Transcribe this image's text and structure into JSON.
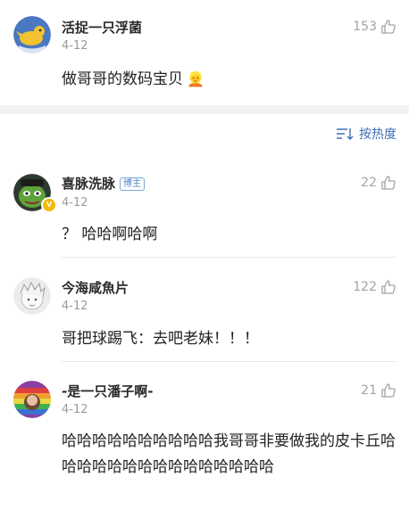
{
  "post": {
    "username": "活捉一只浮菌",
    "date": "4-12",
    "likes": "153",
    "text": "做哥哥的数码宝贝",
    "emoji": "👱"
  },
  "sort": {
    "label": "按热度"
  },
  "comments": [
    {
      "username": "喜脉洗脉",
      "badge": "博主",
      "date": "4-12",
      "likes": "22",
      "text": "？ 哈哈啊哈啊"
    },
    {
      "username": "今海咸魚片",
      "date": "4-12",
      "likes": "122",
      "text": "哥把球踢飞：去吧老妹！！！"
    },
    {
      "username": "-是一只潘子啊-",
      "date": "4-12",
      "likes": "21",
      "text": "哈哈哈哈哈哈哈哈哈哈我哥哥非要做我的皮卡丘哈哈哈哈哈哈哈哈哈哈哈哈哈哈哈"
    }
  ]
}
